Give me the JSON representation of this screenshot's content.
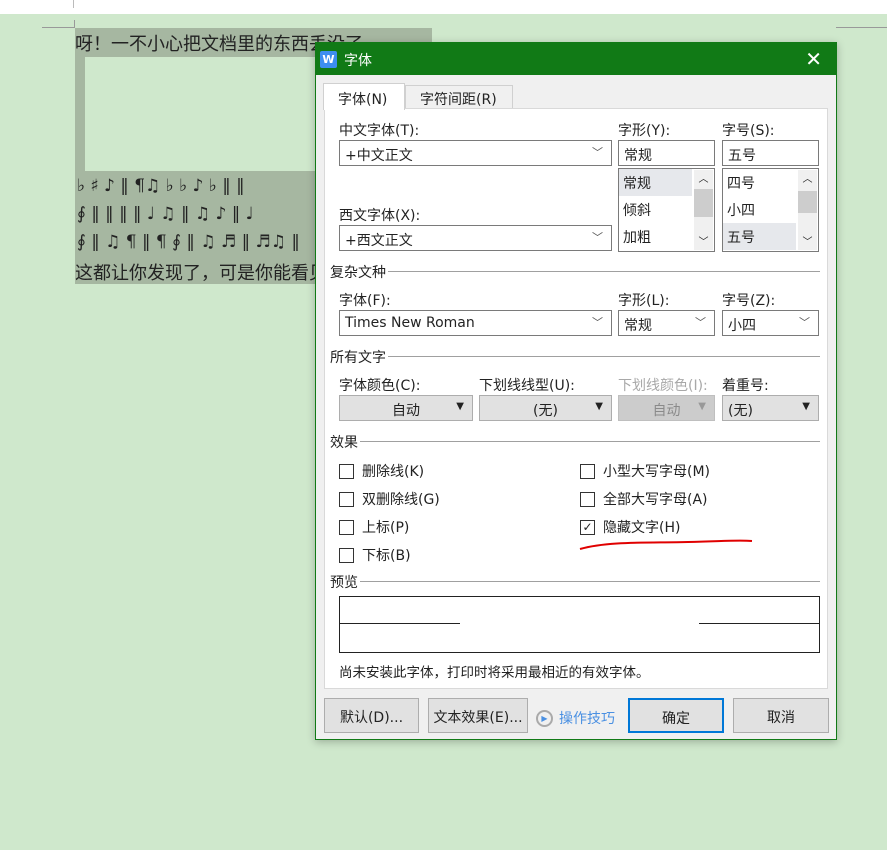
{
  "document": {
    "line1": "呀！一不小心把文档里的东西丢没了……",
    "music1": "♭ ♯ ♪ ‖ ¶♫ ♭ ♭ ♪ ♭ ‖ ‖",
    "music2": "∮ ‖ ‖ ‖ ‖ ♩ ♫ ‖ ♫ ♪ ‖ ♩",
    "music3": "∮ ‖ ♫ ¶ ‖ ¶ ∮ ‖ ♫ ♬ ‖ ♬♫ ‖",
    "line2": "这都让你发现了，可是你能看见吗"
  },
  "dialog": {
    "title": "字体",
    "tabs": [
      {
        "label": "字体(N)",
        "active": true
      },
      {
        "label": "字符间距(R)",
        "active": false
      }
    ],
    "chinese_font": {
      "label": "中文字体(T):",
      "value": "+中文正文"
    },
    "western_font": {
      "label": "西文字体(X):",
      "value": "+西文正文"
    },
    "style": {
      "label": "字形(Y):",
      "value": "常规",
      "options": [
        "常规",
        "倾斜",
        "加粗"
      ],
      "selected": "常规"
    },
    "size": {
      "label": "字号(S):",
      "value": "五号",
      "options": [
        "四号",
        "小四",
        "五号"
      ],
      "selected": "五号"
    },
    "complex": {
      "section": "复杂文种",
      "font_label": "字体(F):",
      "font_value": "Times New Roman",
      "style_label": "字形(L):",
      "style_value": "常规",
      "size_label": "字号(Z):",
      "size_value": "小四"
    },
    "all_text": {
      "section": "所有文字",
      "color_label": "字体颜色(C):",
      "color_value": "自动",
      "underline_label": "下划线线型(U):",
      "underline_value": "(无)",
      "underline_color_label": "下划线颜色(I):",
      "underline_color_value": "自动",
      "emphasis_label": "着重号:",
      "emphasis_value": "(无)"
    },
    "effects": {
      "section": "效果",
      "items": [
        {
          "label": "删除线(K)",
          "checked": false
        },
        {
          "label": "双删除线(G)",
          "checked": false
        },
        {
          "label": "上标(P)",
          "checked": false
        },
        {
          "label": "下标(B)",
          "checked": false
        },
        {
          "label": "小型大写字母(M)",
          "checked": false
        },
        {
          "label": "全部大写字母(A)",
          "checked": false
        },
        {
          "label": "隐藏文字(H)",
          "checked": true
        }
      ]
    },
    "preview": {
      "section": "预览",
      "note": "尚未安装此字体，打印时将采用最相近的有效字体。"
    },
    "buttons": {
      "default": "默认(D)...",
      "text_effects": "文本效果(E)...",
      "tips": "操作技巧",
      "ok": "确定",
      "cancel": "取消"
    },
    "colors": {
      "titlebar": "#117a16",
      "accent": "#0078d7",
      "annotation": "#e00000"
    }
  }
}
